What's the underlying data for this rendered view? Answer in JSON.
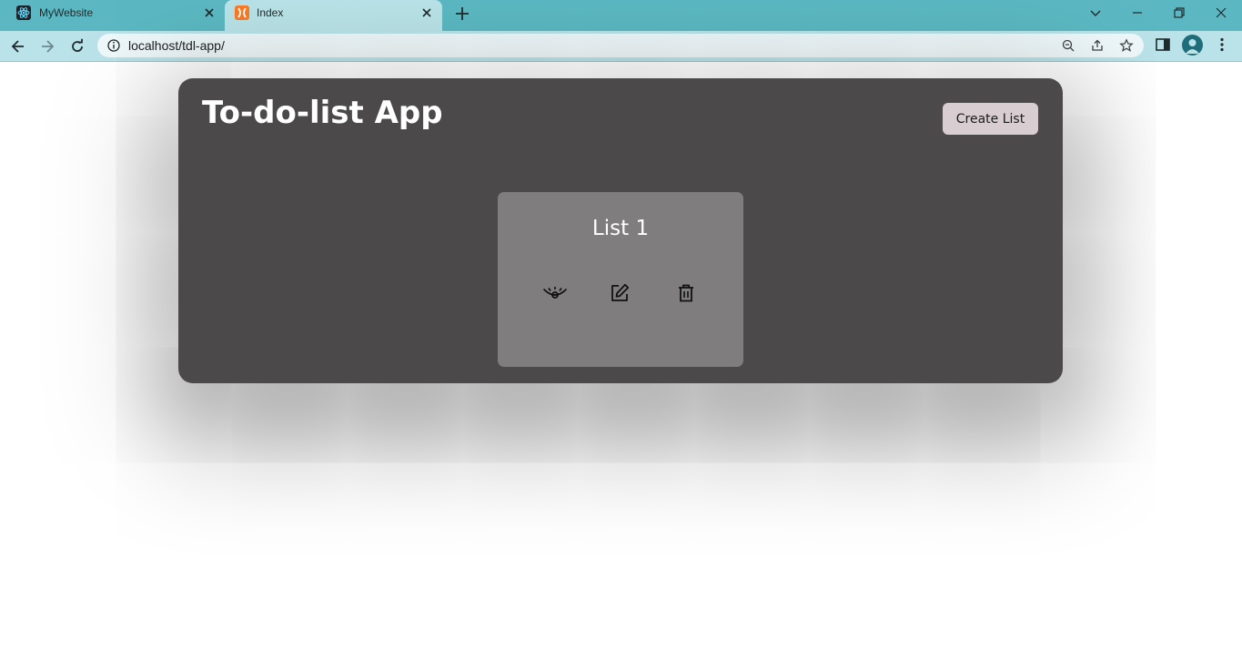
{
  "browser": {
    "tabs": [
      {
        "title": "MyWebsite",
        "icon": "react-icon",
        "active": false
      },
      {
        "title": "Index",
        "icon": "xampp-icon",
        "active": true
      }
    ],
    "url": "localhost/tdl-app/"
  },
  "app": {
    "title": "To-do-list App",
    "create_button_label": "Create List",
    "lists": [
      {
        "title": "List 1",
        "actions": [
          "view-icon",
          "edit-icon",
          "delete-icon"
        ]
      }
    ]
  },
  "colors": {
    "tabstrip": "#5bb8c2",
    "toolbar": "#b9e3e8",
    "app_background": "#4b494a",
    "card_background": "#807d7e",
    "create_button": "#d8cdd0"
  }
}
